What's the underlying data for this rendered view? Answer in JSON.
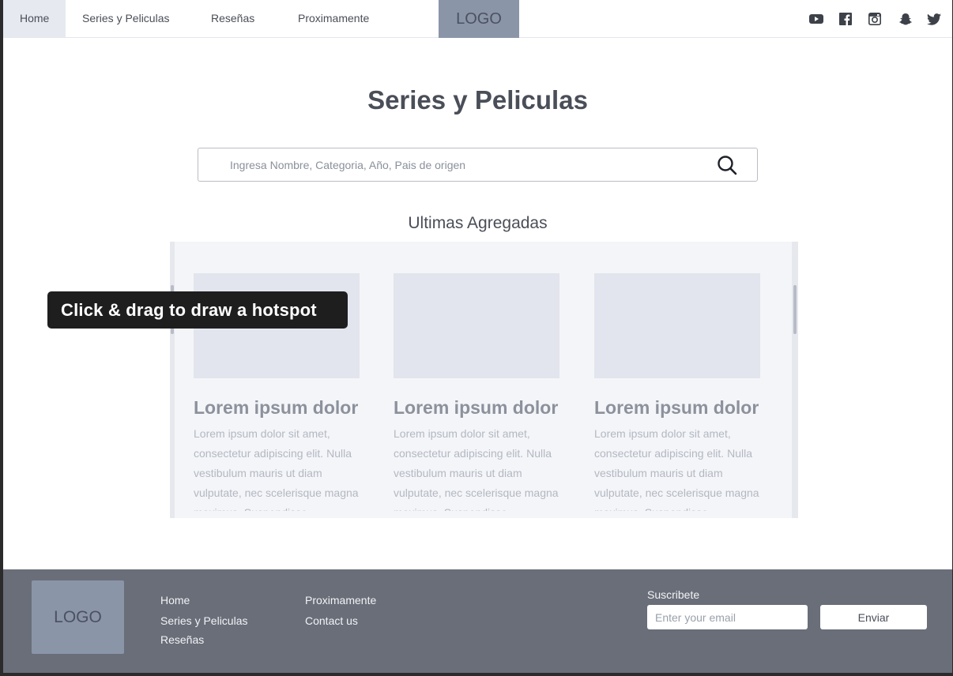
{
  "nav": {
    "items": [
      {
        "label": "Home",
        "active": true
      },
      {
        "label": "Series y Peliculas",
        "active": false
      },
      {
        "label": "Reseñas",
        "active": false
      },
      {
        "label": "Proximamente",
        "active": false
      }
    ],
    "logo": "LOGO",
    "social_icons": [
      "youtube-icon",
      "facebook-icon",
      "instagram-icon",
      "snapchat-icon",
      "twitter-icon"
    ]
  },
  "main": {
    "title": "Series y Peliculas",
    "search": {
      "placeholder": "Ingresa Nombre, Categoria, Año, Pais de origen",
      "value": ""
    },
    "section_title": "Ultimas Agregadas",
    "cards": [
      {
        "title": "Lorem ipsum dolor sit amet",
        "text": "Lorem ipsum dolor sit amet, consectetur adipiscing elit. Nulla vestibulum mauris ut diam vulputate, nec scelerisque magna maximus. Suspendisse"
      },
      {
        "title": "Lorem ipsum dolor sit amet",
        "text": "Lorem ipsum dolor sit amet, consectetur adipiscing elit. Nulla vestibulum mauris ut diam vulputate, nec scelerisque magna maximus. Suspendisse"
      },
      {
        "title": "Lorem ipsum dolor sit amet",
        "text": "Lorem ipsum dolor sit amet, consectetur adipiscing elit. Nulla vestibulum mauris ut diam vulputate, nec scelerisque magna maximus. Suspendisse"
      }
    ]
  },
  "tooltip": {
    "text": "Click & drag to draw a hotspot"
  },
  "footer": {
    "logo": "LOGO",
    "col1": [
      "Home",
      "Series y Peliculas",
      "Reseñas"
    ],
    "col2": [
      "Proximamente",
      "Contact us"
    ],
    "subscribe_label": "Suscribete",
    "email_placeholder": "Enter your email",
    "send_label": "Enviar"
  },
  "colors": {
    "nav_active_bg": "#e6e9f0",
    "logo_bg": "#8a95a8",
    "footer_bg": "#696e79",
    "card_placeholder": "#e2e5ed"
  }
}
